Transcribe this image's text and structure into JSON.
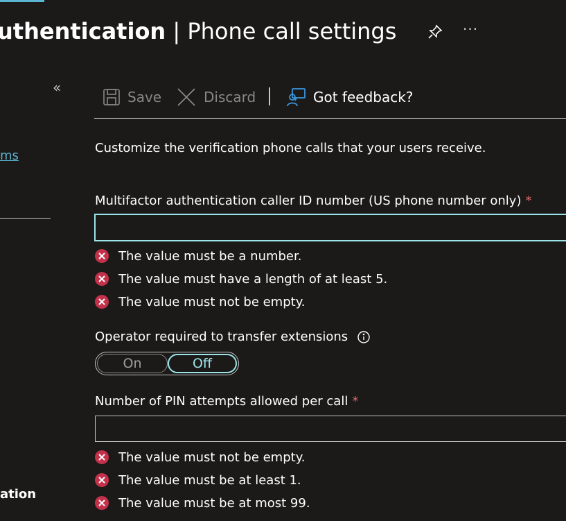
{
  "header": {
    "title_strong": "uthentication",
    "title_rest": " | Phone call settings",
    "more_label": "···"
  },
  "left": {
    "collapse": "«",
    "link_fragment": "ms",
    "bottom_fragment": "ation"
  },
  "toolbar": {
    "save_label": "Save",
    "discard_label": "Discard",
    "feedback_label": "Got feedback?"
  },
  "description": "Customize the verification phone calls that your users receive.",
  "caller_id": {
    "label": "Multifactor authentication caller ID number (US phone number only)",
    "required_mark": "*",
    "value": "",
    "errors": [
      "The value must be a number.",
      "The value must have a length of at least 5.",
      "The value must not be empty."
    ]
  },
  "operator": {
    "label": "Operator required to transfer extensions",
    "on_label": "On",
    "off_label": "Off",
    "selected": "Off"
  },
  "pin_attempts": {
    "label": "Number of PIN attempts allowed per call",
    "required_mark": "*",
    "value": "",
    "errors": [
      "The value must not be empty.",
      "The value must be at least 1.",
      "The value must be at most 99."
    ]
  },
  "colors": {
    "background": "#1b1a19",
    "accent": "#9be4e8",
    "link": "#5ab5d1",
    "error": "#c4314b",
    "required": "#e06c6c"
  },
  "icons": [
    "pin-icon",
    "more-icon",
    "save-icon",
    "discard-icon",
    "feedback-icon",
    "info-icon",
    "error-icon"
  ]
}
